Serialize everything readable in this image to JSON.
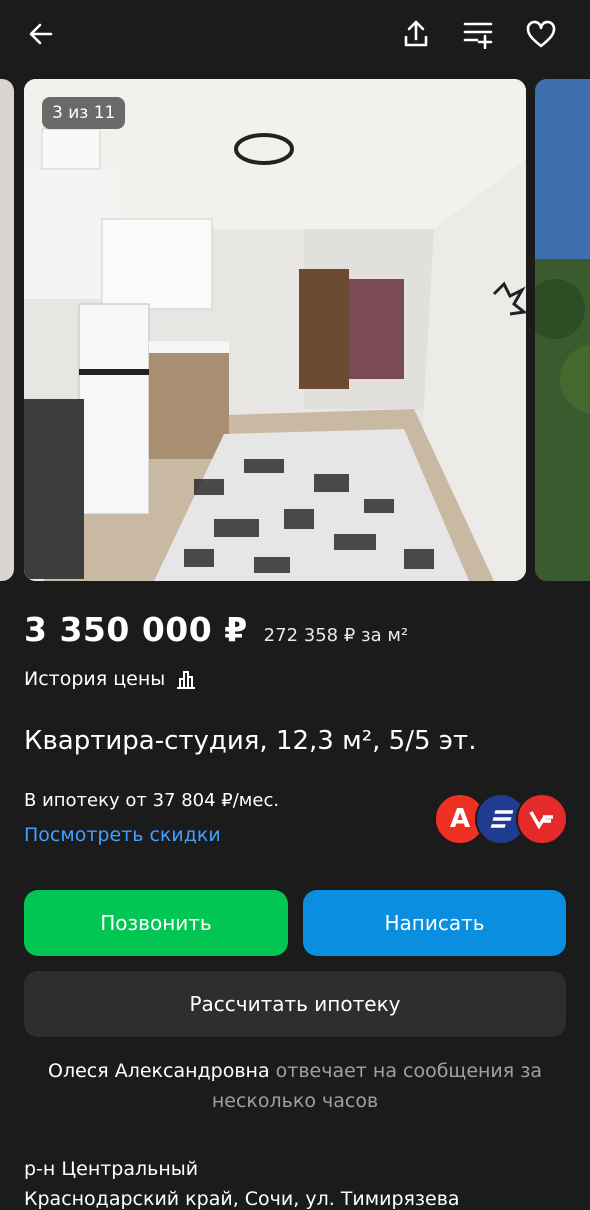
{
  "gallery": {
    "counter": "3 из 11"
  },
  "icons": {
    "back": "arrow-left-icon",
    "share": "share-icon",
    "compare": "compare-icon",
    "favorite": "heart-icon"
  },
  "listing": {
    "price": "3 350 000 ₽",
    "price_per_m": "272 358 ₽ за м²",
    "price_history_label": "История цены",
    "title": "Квартира-студия, 12,3 м², 5/5 эт.",
    "mortgage_text": "В ипотеку от 37 804 ₽/мес.",
    "discounts_link": "Посмотреть скидки"
  },
  "banks": [
    {
      "icon": "alfa-bank-logo",
      "glyph": "А",
      "color": "#ef3124"
    },
    {
      "icon": "bank-stripes-logo",
      "glyph": "",
      "color": "#1f3c91"
    },
    {
      "icon": "bank-v-logo",
      "glyph": "",
      "color": "#e52a2a"
    }
  ],
  "actions": {
    "call": "Позвонить",
    "write": "Написать",
    "calculate": "Рассчитать ипотеку"
  },
  "seller": {
    "name": "Олеся Александровна",
    "response": "отвечает на сообщения за несколько часов"
  },
  "location": {
    "district": "р-н Центральный",
    "address": "Краснодарский край, Сочи, ул. Тимирязева"
  },
  "colors": {
    "background": "#1b1b1b",
    "call_button": "#02c653",
    "write_button": "#0a8ee0",
    "link": "#3ea0ff"
  }
}
